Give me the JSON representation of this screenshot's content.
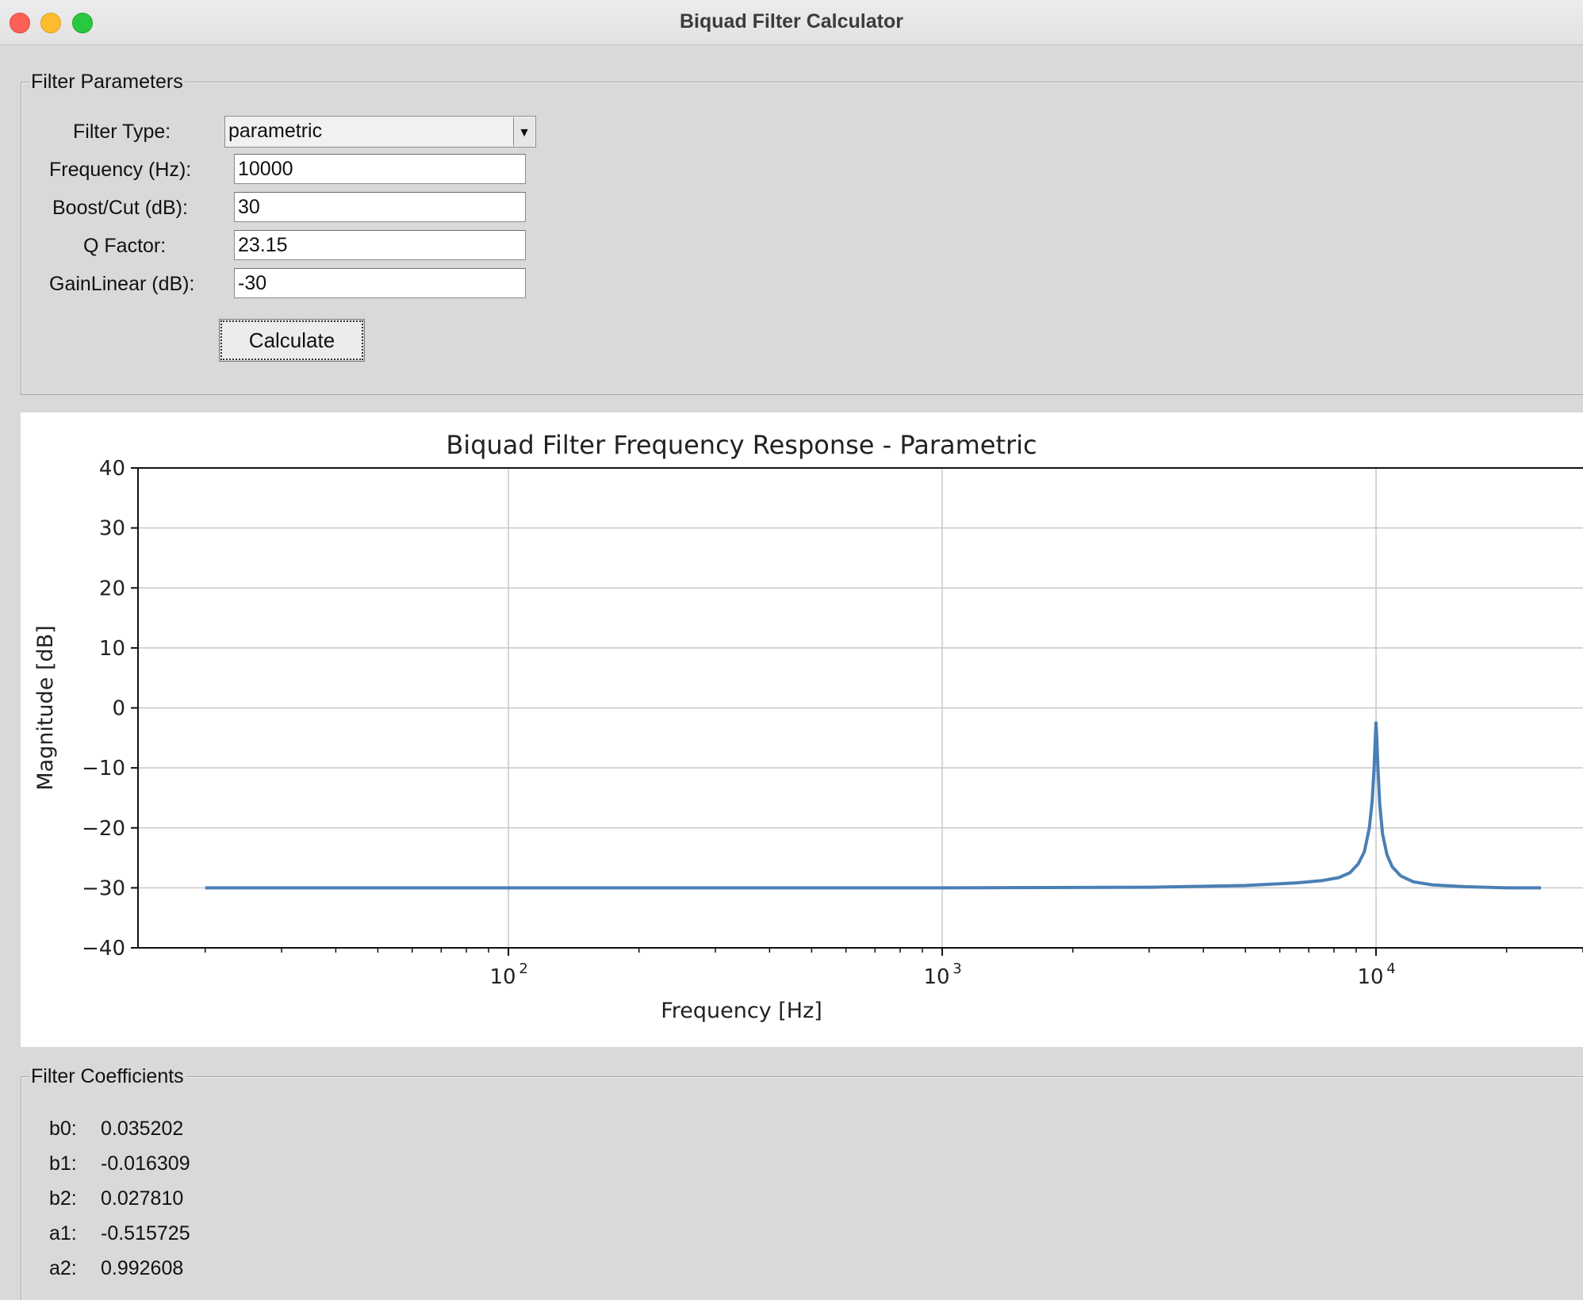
{
  "window": {
    "title": "Biquad Filter Calculator"
  },
  "params": {
    "legend": "Filter Parameters",
    "filter_type_label": "Filter Type:",
    "filter_type_value": "parametric",
    "frequency_label": "Frequency (Hz):",
    "frequency_value": "10000",
    "boost_label": "Boost/Cut (dB):",
    "boost_value": "30",
    "q_label": "Q Factor:",
    "q_value": "23.15",
    "gain_label": "GainLinear (dB):",
    "gain_value": "-30",
    "calculate_label": "Calculate"
  },
  "chart_data": {
    "type": "line",
    "title": "Biquad Filter Frequency Response - Parametric",
    "xlabel": "Frequency [Hz]",
    "ylabel": "Magnitude [dB]",
    "xscale": "log",
    "xlim": [
      14,
      30000
    ],
    "ylim": [
      -40,
      40
    ],
    "yticks": [
      -40,
      -30,
      -20,
      -10,
      0,
      10,
      20,
      30,
      40
    ],
    "ytick_labels": [
      "−40",
      "−30",
      "−20",
      "−10",
      "0",
      "10",
      "20",
      "30",
      "40"
    ],
    "xticks": [
      100,
      1000,
      10000
    ],
    "xtick_labels": [
      {
        "base": "10",
        "exp": "2"
      },
      {
        "base": "10",
        "exp": "3"
      },
      {
        "base": "10",
        "exp": "4"
      }
    ],
    "grid": true,
    "series": [
      {
        "color": "#4a7fb5",
        "x": [
          20,
          100,
          1000,
          3000,
          5000,
          6500,
          7500,
          8200,
          8700,
          9100,
          9400,
          9650,
          9800,
          9900,
          9960,
          10000,
          10040,
          10100,
          10200,
          10350,
          10600,
          10900,
          11400,
          12200,
          13500,
          16000,
          20000,
          24000
        ],
        "y": [
          -30,
          -30,
          -30,
          -29.9,
          -29.6,
          -29.2,
          -28.8,
          -28.3,
          -27.5,
          -26,
          -24,
          -20,
          -15.5,
          -10,
          -5,
          -2.5,
          -5,
          -10,
          -16,
          -21,
          -24.5,
          -26.5,
          -28,
          -29,
          -29.5,
          -29.8,
          -30,
          -30
        ]
      }
    ]
  },
  "coefficients": {
    "legend": "Filter Coefficients",
    "rows": [
      {
        "name": "b0:",
        "value": "0.035202"
      },
      {
        "name": "b1:",
        "value": "-0.016309"
      },
      {
        "name": "b2:",
        "value": "0.027810"
      },
      {
        "name": "a1:",
        "value": "-0.515725"
      },
      {
        "name": "a2:",
        "value": "0.992608"
      }
    ]
  }
}
